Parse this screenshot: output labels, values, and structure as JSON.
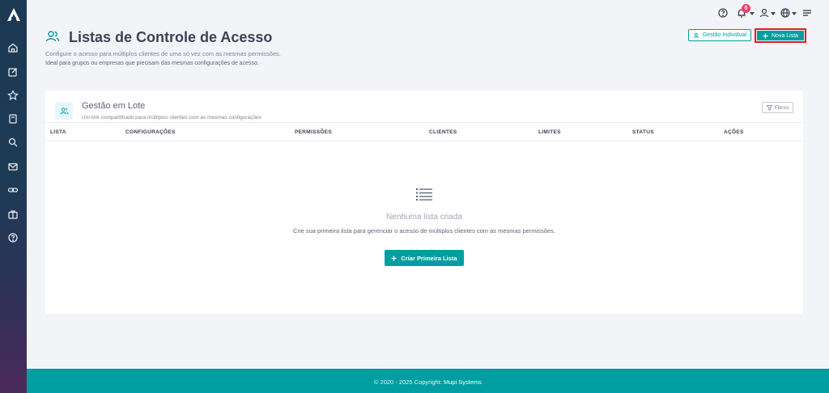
{
  "header": {
    "title": "Listas de Controle de Acesso",
    "subtitle": "Configure o acesso para múltiplos clientes de uma só vez com as mesmas permissões.",
    "description": "Ideal para grupos ou empresas que precisam das mesmas configurações de acesso.",
    "icon": "users-icon"
  },
  "topbar": {
    "notification_count": "0",
    "icons": [
      "help-icon",
      "bell-icon",
      "user-icon",
      "globe-icon",
      "menu-icon"
    ]
  },
  "actions": {
    "individual_label": "Gestão Individual",
    "new_list_label": "Nova Lista"
  },
  "sidebar": {
    "logo": "logo-icon",
    "items": [
      "home-icon",
      "edit-icon",
      "star-icon",
      "book-icon",
      "search-icon",
      "mail-icon",
      "link-icon",
      "briefcase-icon",
      "help-icon"
    ]
  },
  "card": {
    "title": "Gestão em Lote",
    "subtitle": "Um link compartilhado para múltiplos clientes com as mesmas configurações",
    "filter_label": "Filtros",
    "columns": [
      "LISTA",
      "CONFIGURAÇÕES",
      "PERMISSÕES",
      "CLIENTES",
      "LIMITES",
      "STATUS",
      "AÇÕES"
    ],
    "empty": {
      "title": "Nenhuma lista criada",
      "text": "Crie sua primeira lista para gerenciar o acesso de múltiplos clientes com as mesmas permissões.",
      "button_label": "Criar Primeira Lista"
    }
  },
  "footer": {
    "copyright": "© 2020 - 2025 Copyright:",
    "company": "Mupi Systems"
  },
  "colors": {
    "accent": "#009ea0",
    "highlight": "#e01e1e",
    "badge": "#f1416c"
  }
}
